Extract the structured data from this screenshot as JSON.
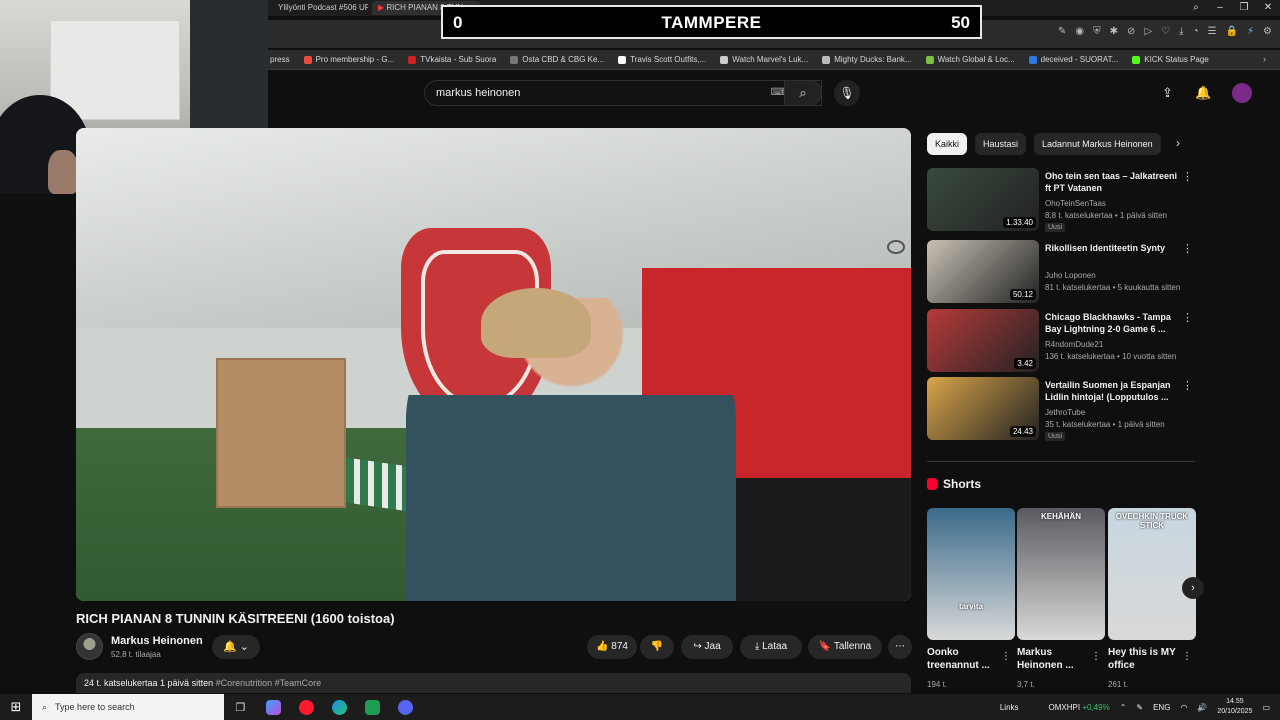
{
  "browser": {
    "tabs": [
      {
        "label": "Ylilyönti Podcast #506 UF"
      },
      {
        "label": "RICH PIANAN 8 TUN"
      }
    ],
    "bookmarks": [
      {
        "label": "press",
        "color": "#888888"
      },
      {
        "label": "Pro membership - G...",
        "color": "#e84c3d"
      },
      {
        "label": "TVkaista - Sub Suora",
        "color": "#cc2222"
      },
      {
        "label": "Osta CBD & CBG Ke...",
        "color": "#777777"
      },
      {
        "label": "Travis Scott Outfits,...",
        "color": "#ffffff"
      },
      {
        "label": "Watch Marvel's Luk...",
        "color": "#cccccc"
      },
      {
        "label": "Mighty Ducks: Bank...",
        "color": "#bbbbbb"
      },
      {
        "label": "Watch Global & Loc...",
        "color": "#7fbf3f"
      },
      {
        "label": "deceived - SUORAT...",
        "color": "#2d7be0"
      },
      {
        "label": "KICK Status Page",
        "color": "#53fc18"
      }
    ]
  },
  "scoreboard": {
    "left": "0",
    "center": "TAMMPERE",
    "right": "50"
  },
  "search": {
    "query": "markus heinonen"
  },
  "video": {
    "title": "RICH PIANAN 8 TUNNIN KÄSITREENI (1600 toistoa)",
    "channel": "Markus Heinonen",
    "subscribers": "52,8 t. tilaajaa",
    "likes": "874",
    "share": "Jaa",
    "download": "Lataa",
    "save": "Tallenna",
    "views_date": "24 t. katselukertaa  1 päivä sitten",
    "tags": "#Corenutrition #TeamCore"
  },
  "chips": [
    {
      "label": "Kaikki",
      "selected": true
    },
    {
      "label": "Haustasi",
      "selected": false
    },
    {
      "label": "Ladannut Markus Heinonen",
      "selected": false
    }
  ],
  "recommendations": [
    {
      "title": "Oho tein sen taas – Jalkatreeni ft PT Vatanen",
      "channel": "OhoTeinSenTaas",
      "meta": "8,8 t. katselukertaa • 1 päivä sitten",
      "badge": "Uusi",
      "duration": "1.33.40",
      "thumb": "#3a4a3e"
    },
    {
      "title": "Rikollisen Identiteetin Synty",
      "channel": "Juho Loponen",
      "meta": "81 t. katselukertaa • 5 kuukautta sitten",
      "badge": "",
      "duration": "50.12",
      "thumb": "#c9c2b6"
    },
    {
      "title": "Chicago Blackhawks - Tampa Bay Lightning 2-0 Game 6 ...",
      "channel": "R4ndomDude21",
      "meta": "136 t. katselukertaa • 10 vuotta sitten",
      "badge": "",
      "duration": "3.42",
      "thumb": "#b83a3a"
    },
    {
      "title": "Vertailin Suomen ja Espanjan Lidlin hintoja! (Lopputulos ...",
      "channel": "JethroTube",
      "meta": "35 t. katselukertaa • 1 päivä sitten",
      "badge": "Uusi",
      "duration": "24.43",
      "thumb": "#d9a54a"
    }
  ],
  "shorts": {
    "header": "Shorts",
    "items": [
      {
        "title": "Oonko treenannut ...",
        "views": "194 t.",
        "thumb": "#3a6a8a",
        "caption": "tarvita"
      },
      {
        "title": "Markus Heinonen ...",
        "views": "3,7 t.",
        "thumb": "#5a5a60",
        "caption": "KEHÄHÄN"
      },
      {
        "title": "Hey this is MY office",
        "views": "261 t.",
        "thumb": "#c8d6e0",
        "caption": "OVECHKIN TRUCK STICK"
      }
    ]
  },
  "taskbar": {
    "search_placeholder": "Type here to search",
    "links": "Links",
    "stock": "OMXHPI",
    "stock_change": "+0,49%",
    "lang": "ENG",
    "time": "14.55",
    "date": "20/10/2025"
  }
}
